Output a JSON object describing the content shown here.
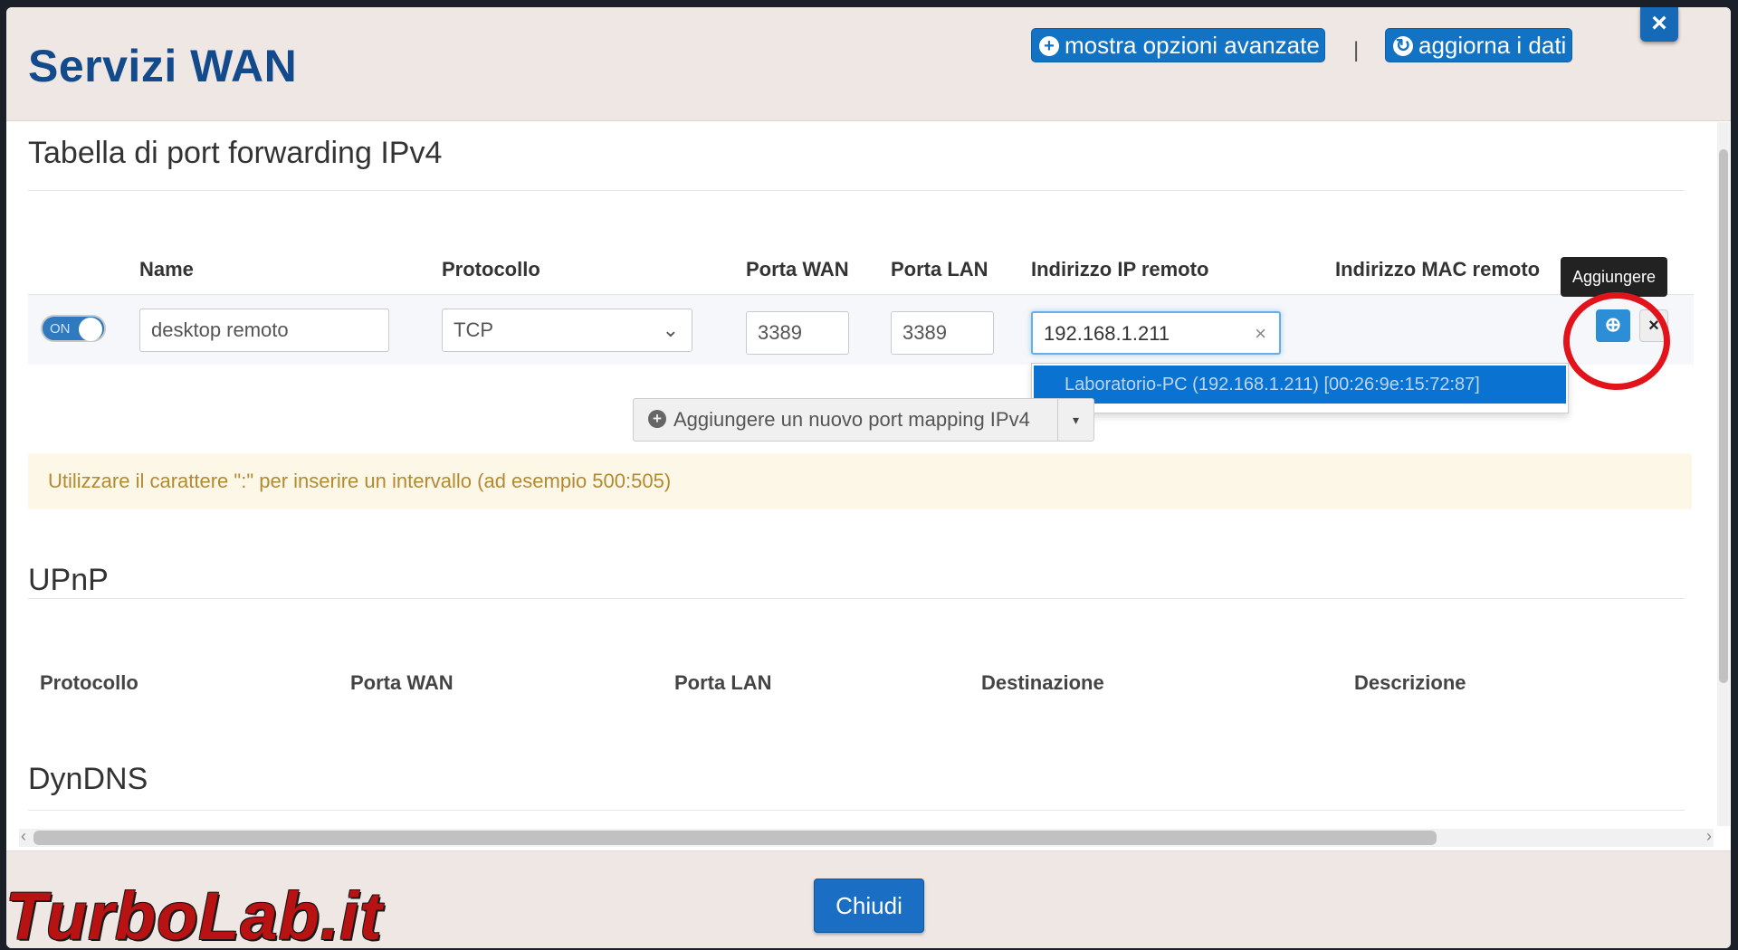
{
  "header": {
    "title": "Servizi WAN",
    "advanced_label": "mostra opzioni avanzate",
    "separator": "|",
    "refresh_label": "aggiorna i dati"
  },
  "port_forwarding": {
    "title": "Tabella di port forwarding IPv4",
    "columns": [
      "Name",
      "Protocollo",
      "Porta WAN",
      "Porta LAN",
      "Indirizzo IP remoto",
      "Indirizzo MAC remoto"
    ],
    "row": {
      "toggle_label": "ON",
      "name": "desktop remoto",
      "protocol": "TCP",
      "wan_port": "3389",
      "lan_port": "3389",
      "remote_ip": "192.168.1.211"
    },
    "suggestion": "Laboratorio-PC (192.168.1.211) [00:26:9e:15:72:87]",
    "tooltip": "Aggiungere",
    "add_mapping_label": "Aggiungere un nuovo port mapping IPv4",
    "hint": "Utilizzare il carattere \":\" per inserire un intervallo (ad esempio 500:505)"
  },
  "upnp": {
    "title": "UPnP",
    "columns": [
      "Protocollo",
      "Porta WAN",
      "Porta LAN",
      "Destinazione",
      "Descrizione"
    ]
  },
  "dyndns": {
    "title": "DynDNS"
  },
  "footer": {
    "close_label": "Chiudi"
  },
  "watermark": "TurboLab.it",
  "colors": {
    "accent": "#1272c4",
    "title": "#124a8c",
    "highlight_ring": "#e3131b",
    "alert_bg": "#fcf7e6"
  }
}
